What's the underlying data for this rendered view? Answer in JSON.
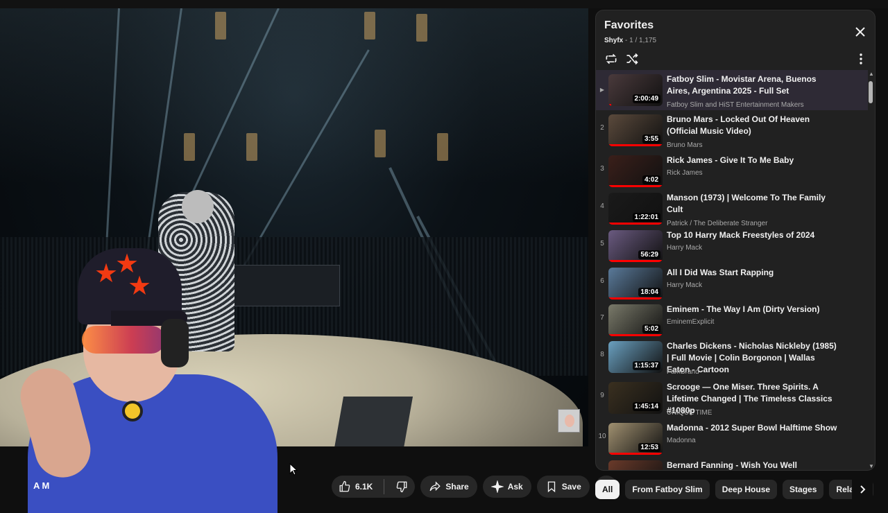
{
  "video": {
    "channel_fragment": "A M"
  },
  "actions": {
    "likes": "6.1K",
    "share_label": "Share",
    "ask_label": "Ask",
    "save_label": "Save"
  },
  "playlist": {
    "title": "Favorites",
    "owner": "Shyfx",
    "position": " - 1 / 1,175",
    "items": [
      {
        "index": "▶",
        "title": "Fatboy Slim - Movistar Arena, Buenos Aires, Argentina 2025 - Full Set",
        "channel": "Fatboy Slim and HiST Entertainment Makers",
        "duration": "2:00:49",
        "thumb_color": "#4a3a3c",
        "progress": 0.05,
        "active": true
      },
      {
        "index": "2",
        "title": "Bruno Mars - Locked Out Of Heaven (Official Music Video)",
        "channel": "Bruno Mars",
        "duration": "3:55",
        "thumb_color": "#5b4a3c",
        "progress": 1.0
      },
      {
        "index": "3",
        "title": "Rick James - Give It To Me Baby",
        "channel": "Rick James",
        "duration": "4:02",
        "thumb_color": "#3a1f1a",
        "progress": 1.0
      },
      {
        "index": "4",
        "title": "Manson (1973) | Welcome To The Family Cult",
        "channel": "Patrick / The Deliberate Stranger",
        "duration": "1:22:01",
        "thumb_color": "#1a1a1a",
        "progress": 1.0
      },
      {
        "index": "5",
        "title": "Top 10 Harry Mack Freestyles of 2024",
        "channel": "Harry Mack",
        "duration": "56:29",
        "thumb_color": "#6a5a80",
        "progress": 1.0
      },
      {
        "index": "6",
        "title": "All I Did Was Start Rapping",
        "channel": "Harry Mack",
        "duration": "18:04",
        "thumb_color": "#5a7a9a",
        "progress": 1.0
      },
      {
        "index": "7",
        "title": "Eminem - The Way I Am (Dirty Version)",
        "channel": "EminemExplicit",
        "duration": "5:02",
        "thumb_color": "#7a7a6a",
        "progress": 1.0
      },
      {
        "index": "8",
        "title": "Charles Dickens - Nicholas Nickleby (1985) | Full Movie | Colin Borgonon | Wallas Eaton - Cartoon",
        "channel": "FamBrand",
        "duration": "1:15:37",
        "thumb_color": "#6aa0c0",
        "progress": 0.0
      },
      {
        "index": "9",
        "title": "Scrooge — One Miser. Three Spirits. A Lifetime Changed | The Timeless Classics #1080p",
        "channel": "UNIQUE TIME",
        "duration": "1:45:14",
        "thumb_color": "#3a3020",
        "progress": 0.0
      },
      {
        "index": "10",
        "title": "Madonna - 2012 Super Bowl Halftime Show",
        "channel": "Madonna",
        "duration": "12:53",
        "thumb_color": "#a09070",
        "progress": 1.0
      },
      {
        "index": "11",
        "title": "Bernard Fanning - Wish You Well",
        "channel": "",
        "duration": "",
        "thumb_color": "#6a3a2a",
        "progress": 0.0
      }
    ]
  },
  "chips": [
    "All",
    "From Fatboy Slim",
    "Deep House",
    "Stages",
    "Related"
  ],
  "icons": {
    "close": "close-icon",
    "loop": "loop-icon",
    "shuffle": "shuffle-icon",
    "more": "more-vert-icon",
    "like": "thumb-up-icon",
    "dislike": "thumb-down-icon",
    "share": "share-icon",
    "ask": "sparkle-icon",
    "save": "bookmark-icon",
    "next": "chevron-right-icon"
  }
}
